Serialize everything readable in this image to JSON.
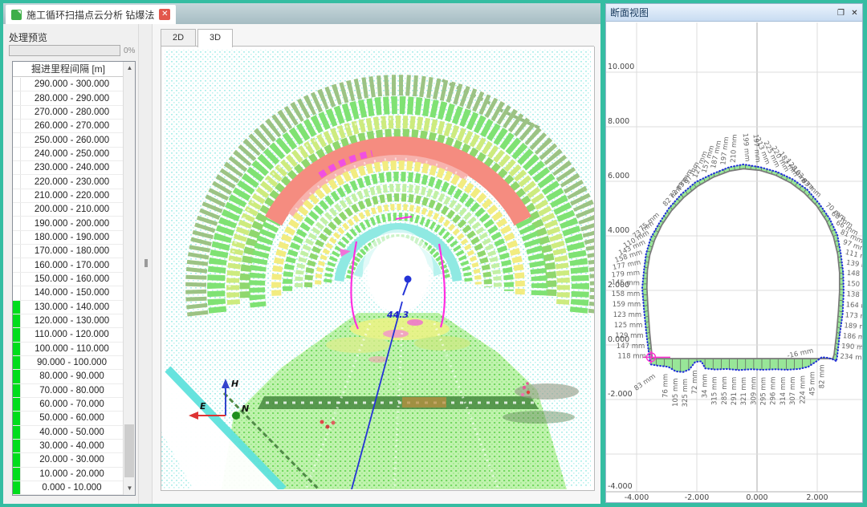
{
  "app": {
    "border_color": "#35bda2",
    "doc_tab": {
      "title": "施工循环扫描点云分析 钻爆法"
    }
  },
  "left_panel": {
    "preview_label": "处理预览",
    "progress_percent": "0%",
    "list": {
      "header": "掘进里程间隔 [m]",
      "scroll_up_glyph": "▲",
      "scroll_down_glyph": "▼",
      "highlight_color": "#00dd1c",
      "rows": [
        {
          "range": "290.000 - 300.000",
          "highlighted": false
        },
        {
          "range": "280.000 - 290.000",
          "highlighted": false
        },
        {
          "range": "270.000 - 280.000",
          "highlighted": false
        },
        {
          "range": "260.000 - 270.000",
          "highlighted": false
        },
        {
          "range": "250.000 - 260.000",
          "highlighted": false
        },
        {
          "range": "240.000 - 250.000",
          "highlighted": false
        },
        {
          "range": "230.000 - 240.000",
          "highlighted": false
        },
        {
          "range": "220.000 - 230.000",
          "highlighted": false
        },
        {
          "range": "210.000 - 220.000",
          "highlighted": false
        },
        {
          "range": "200.000 - 210.000",
          "highlighted": false
        },
        {
          "range": "190.000 - 200.000",
          "highlighted": false
        },
        {
          "range": "180.000 - 190.000",
          "highlighted": false
        },
        {
          "range": "170.000 - 180.000",
          "highlighted": false
        },
        {
          "range": "160.000 - 170.000",
          "highlighted": false
        },
        {
          "range": "150.000 - 160.000",
          "highlighted": false
        },
        {
          "range": "140.000 - 150.000",
          "highlighted": false
        },
        {
          "range": "130.000 - 140.000",
          "highlighted": true
        },
        {
          "range": "120.000 - 130.000",
          "highlighted": true
        },
        {
          "range": "110.000 - 120.000",
          "highlighted": true
        },
        {
          "range": "100.000 - 110.000",
          "highlighted": true
        },
        {
          "range": "90.000 - 100.000",
          "highlighted": true
        },
        {
          "range": "80.000 - 90.000",
          "highlighted": true
        },
        {
          "range": "70.000 - 80.000",
          "highlighted": true
        },
        {
          "range": "60.000 - 70.000",
          "highlighted": true
        },
        {
          "range": "50.000 - 60.000",
          "highlighted": true
        },
        {
          "range": "40.000 - 50.000",
          "highlighted": true
        },
        {
          "range": "30.000 - 40.000",
          "highlighted": true
        },
        {
          "range": "20.000 - 30.000",
          "highlighted": true
        },
        {
          "range": "10.000 - 20.000",
          "highlighted": true
        },
        {
          "range": "0.000 - 10.000",
          "highlighted": true
        }
      ]
    }
  },
  "center_panel": {
    "tabs": [
      {
        "label": "2D",
        "active": false
      },
      {
        "label": "3D",
        "active": true
      }
    ],
    "viewport": {
      "annotation": "44.3",
      "axis_triad": {
        "up": "H",
        "east": "E",
        "north": "N"
      },
      "palette": {
        "sage": "#9cc384",
        "green": "#7fe273",
        "green2": "#8fd76d",
        "yellowGreen": "#cdeb7e",
        "salmon": "#f58c80",
        "magenta": "#f14fe2",
        "pinkLight": "#f7b3ae",
        "yellow": "#f2ec80",
        "paleGreen": "#c2f0a4",
        "cyanInner": "#8fe9e2",
        "cyanPale": "#b7f2ee",
        "floor": "#c0f3ae",
        "floorDot": "#74d862",
        "bgDot": "#aeeeea"
      }
    }
  },
  "right_panel": {
    "title": "断面视图",
    "chart_data": {
      "type": "scatter",
      "title": "断面视图",
      "xlabel": "",
      "ylabel": "",
      "grid": true,
      "legend": false,
      "x_ticks": [
        "-4.000",
        "-2.000",
        "0.000",
        "2.000"
      ],
      "y_ticks": [
        "10.000",
        "8.000",
        "6.000",
        "4.000",
        "2.000",
        "0.000",
        "-2.000",
        "-4.000"
      ],
      "x_tick_values": [
        -4,
        -2,
        0,
        2
      ],
      "y_tick_values": [
        10,
        8,
        6,
        4,
        2,
        0,
        -2,
        -4
      ],
      "x_range": [
        -4.5,
        3.5
      ],
      "y_range": [
        -4.5,
        11.0
      ],
      "unit": "mm",
      "design_profile": [
        [
          -3.48,
          -0.5
        ],
        [
          -3.56,
          0.4
        ],
        [
          -3.62,
          1.3
        ],
        [
          -3.66,
          2.1
        ],
        [
          -3.64,
          2.75
        ],
        [
          -3.56,
          3.3
        ],
        [
          -3.4,
          3.85
        ],
        [
          -3.16,
          4.4
        ],
        [
          -2.84,
          4.92
        ],
        [
          -2.44,
          5.4
        ],
        [
          -1.97,
          5.82
        ],
        [
          -1.45,
          6.15
        ],
        [
          -0.9,
          6.38
        ],
        [
          -0.45,
          6.46
        ],
        [
          0.1,
          6.4
        ],
        [
          0.62,
          6.22
        ],
        [
          1.12,
          5.94
        ],
        [
          1.58,
          5.56
        ],
        [
          1.98,
          5.1
        ],
        [
          2.3,
          4.56
        ],
        [
          2.54,
          3.96
        ],
        [
          2.68,
          3.32
        ],
        [
          2.74,
          2.65
        ],
        [
          2.74,
          1.95
        ],
        [
          2.7,
          1.2
        ],
        [
          2.64,
          0.4
        ],
        [
          2.56,
          -0.35
        ],
        [
          2.52,
          -0.5
        ]
      ],
      "measured_floor": [
        [
          -3.6,
          -0.7
        ],
        [
          -3.3,
          -0.76
        ],
        [
          -2.95,
          -0.8
        ],
        [
          -2.7,
          -0.97
        ],
        [
          -2.45,
          -0.99
        ],
        [
          -2.25,
          -0.9
        ],
        [
          -2.05,
          -0.62
        ],
        [
          -1.85,
          -0.6
        ],
        [
          -1.72,
          -0.86
        ],
        [
          -1.4,
          -0.9
        ],
        [
          -1.0,
          -0.88
        ],
        [
          -0.6,
          -0.92
        ],
        [
          -0.2,
          -0.89
        ],
        [
          0.2,
          -0.91
        ],
        [
          0.6,
          -0.89
        ],
        [
          1.0,
          -0.91
        ],
        [
          1.4,
          -0.88
        ],
        [
          1.7,
          -0.8
        ],
        [
          1.95,
          -0.62
        ],
        [
          2.15,
          -0.45
        ],
        [
          2.35,
          -0.47
        ],
        [
          2.58,
          -0.55
        ]
      ],
      "wall_overbreak_mm": [
        118,
        147,
        129,
        125,
        123,
        159,
        158,
        145,
        179,
        177,
        158,
        143,
        110,
        73,
        75,
        82,
        72,
        73,
        97,
        127,
        157,
        187,
        197,
        210,
        199,
        197,
        213,
        225,
        220,
        183,
        128,
        103,
        83,
        70,
        68,
        66,
        81,
        97,
        111,
        139,
        148,
        150,
        138,
        164,
        173,
        189,
        186,
        190,
        234
      ],
      "floor_overbreak_mm": [
        83,
        76,
        105,
        325,
        72,
        34,
        315,
        285,
        291,
        321,
        309,
        295,
        296,
        314,
        307,
        224,
        45,
        82
      ],
      "corner_overbreak_mm": -16,
      "colors": {
        "design_line": "#7a7a7a",
        "measured_line": "#2230d8",
        "band_fill": "#98e698",
        "marker": "#ff2fd0",
        "grid_line": "#dcdcdc",
        "grid_line_zero": "#a8a8a8",
        "label_text": "#666666"
      }
    }
  }
}
